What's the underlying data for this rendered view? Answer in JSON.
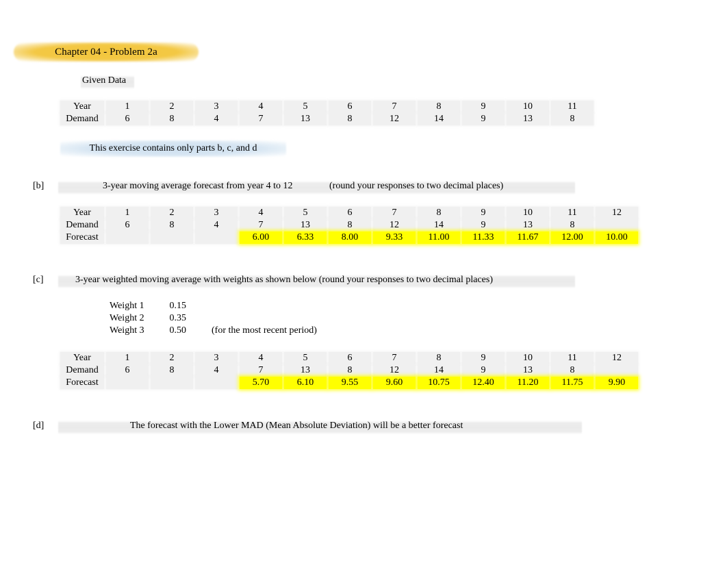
{
  "title": "Chapter 04 - Problem 2a",
  "given": {
    "label": "Given Data",
    "row_labels": [
      "Year",
      "Demand"
    ],
    "years": [
      "1",
      "2",
      "3",
      "4",
      "5",
      "6",
      "7",
      "8",
      "9",
      "10",
      "11"
    ],
    "demand": [
      "6",
      "8",
      "4",
      "7",
      "13",
      "8",
      "12",
      "14",
      "9",
      "13",
      "8"
    ]
  },
  "note": {
    "text": "This exercise contains only parts b, c, and d",
    "band_color": "#d6e5f2"
  },
  "sections": {
    "b": {
      "tag": "[b]",
      "heading": "3-year moving average forecast from year 4 to 12",
      "rounding_note": "(round your responses to two decimal places)",
      "table": {
        "row_labels": [
          "Year",
          "Demand",
          "Forecast"
        ],
        "years": [
          "1",
          "2",
          "3",
          "4",
          "5",
          "6",
          "7",
          "8",
          "9",
          "10",
          "11",
          "12"
        ],
        "demand": [
          "6",
          "8",
          "4",
          "7",
          "13",
          "8",
          "12",
          "14",
          "9",
          "13",
          "8",
          ""
        ],
        "forecast": [
          "",
          "",
          "",
          "6.00",
          "6.33",
          "8.00",
          "9.33",
          "11.00",
          "11.33",
          "11.67",
          "12.00",
          "10.00"
        ]
      }
    },
    "c": {
      "tag": "[c]",
      "heading": "3-year weighted moving average with weights as shown below (round your responses to two decimal places)",
      "weights": [
        {
          "label": "Weight 1",
          "value": "0.15",
          "note": ""
        },
        {
          "label": "Weight 2",
          "value": "0.35",
          "note": ""
        },
        {
          "label": "Weight 3",
          "value": "0.50",
          "note": "(for the most recent period)"
        }
      ],
      "table": {
        "row_labels": [
          "Year",
          "Demand",
          "Forecast"
        ],
        "years": [
          "1",
          "2",
          "3",
          "4",
          "5",
          "6",
          "7",
          "8",
          "9",
          "10",
          "11",
          "12"
        ],
        "demand": [
          "6",
          "8",
          "4",
          "7",
          "13",
          "8",
          "12",
          "14",
          "9",
          "13",
          "8",
          ""
        ],
        "forecast": [
          "",
          "",
          "",
          "5.70",
          "6.10",
          "9.55",
          "9.60",
          "10.75",
          "12.40",
          "11.20",
          "11.75",
          "9.90"
        ]
      }
    },
    "d": {
      "tag": "[d]",
      "heading": "The forecast with the Lower MAD (Mean Absolute Deviation) will be a better forecast"
    }
  },
  "colors": {
    "title_highlight": "#f2c53d",
    "answer_highlight": "#ffff00",
    "cell_background": "#f0f0f0",
    "note_highlight": "#d6e5f2"
  }
}
